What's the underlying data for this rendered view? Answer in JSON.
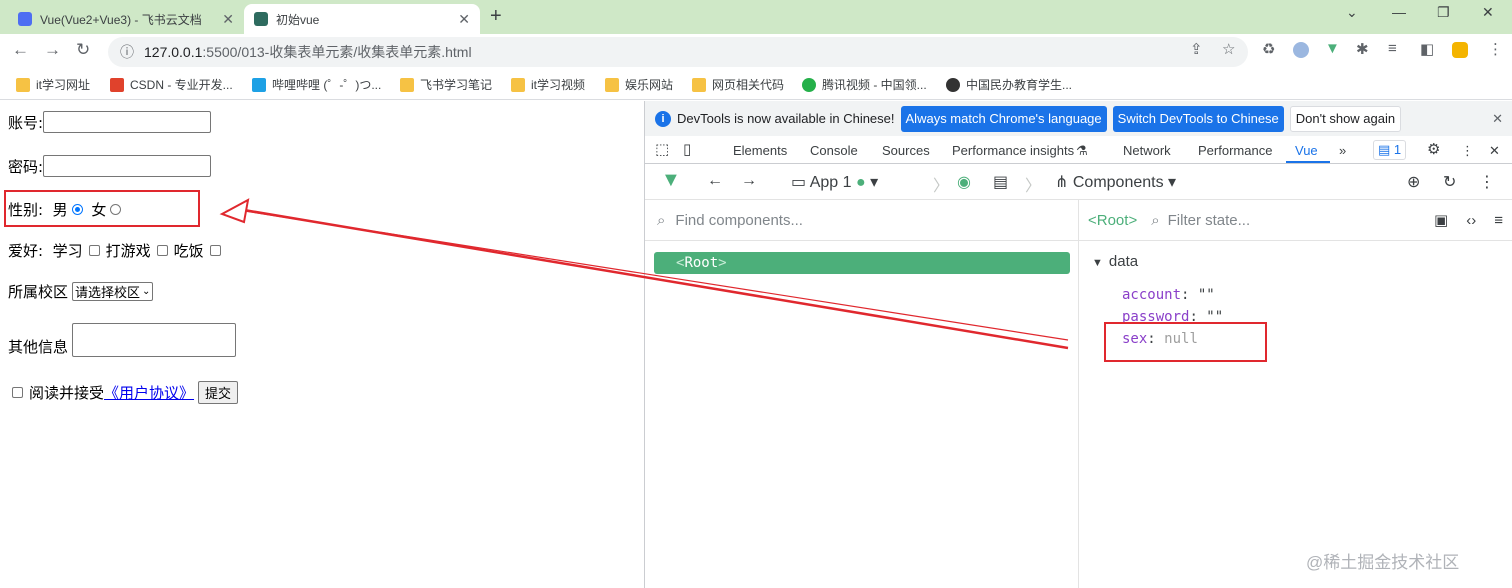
{
  "tabs": [
    {
      "title": "Vue(Vue2+Vue3) - 飞书云文档",
      "favicon_color": "#4e6ef2"
    },
    {
      "title": "初始vue",
      "favicon_color": "#2e6b5f"
    }
  ],
  "toolbar": {
    "url_host": "127.0.0.1",
    "url_path": ":5500/013-收集表单元素/收集表单元素.html"
  },
  "bookmarks": [
    {
      "label": "it学习网址",
      "icon_color": "#f6c244"
    },
    {
      "label": "CSDN - 专业开发...",
      "icon_color": "#e0422c"
    },
    {
      "label": "哔哩哔哩 (゜-゜)つ...",
      "icon_color": "#1ea1e5"
    },
    {
      "label": "飞书学习笔记",
      "icon_color": "#f6c244"
    },
    {
      "label": "it学习视频",
      "icon_color": "#f6c244"
    },
    {
      "label": "娱乐网站",
      "icon_color": "#f6c244"
    },
    {
      "label": "网页相关代码",
      "icon_color": "#f6c244"
    },
    {
      "label": "腾讯视频 - 中国领...",
      "icon_color": "#25b04a"
    },
    {
      "label": "中国民办教育学生...",
      "icon_color": "#333333"
    }
  ],
  "form": {
    "account_label": "账号:",
    "password_label": "密码:",
    "sex_label": "性别:",
    "male": "男",
    "female": "女",
    "hobby_label": "爱好:",
    "hobby_study": "学习",
    "hobby_game": "打游戏",
    "hobby_eat": "吃饭",
    "campus_label": "所属校区",
    "campus_select": "请选择校区",
    "other_label": "其他信息",
    "agree_text": "阅读并接受",
    "agreement_link": "《用户协议》",
    "submit": "提交"
  },
  "devtools": {
    "info_text": "DevTools is now available in Chinese!",
    "btn_match": "Always match Chrome's language",
    "btn_switch": "Switch DevTools to Chinese",
    "btn_dont_show": "Don't show again",
    "tabs": [
      "Elements",
      "Console",
      "Sources",
      "Performance insights",
      "Network",
      "Performance",
      "Vue"
    ],
    "issues_count": "1",
    "app_label": "App 1",
    "components_label": "Components",
    "find_placeholder": "Find components...",
    "root_tag": "Root",
    "selected_root": "<Root>",
    "filter_placeholder": "Filter state...",
    "data_section": "data",
    "state": [
      {
        "key": "account",
        "value": "\"\""
      },
      {
        "key": "password",
        "value": "\"\""
      },
      {
        "key": "sex",
        "value": "null"
      }
    ]
  },
  "watermark": "@稀土掘金技术社区",
  "colors": {
    "annotation_red": "#e0282e",
    "vue_green": "#4caf7a",
    "chrome_blue": "#1a73e8"
  }
}
